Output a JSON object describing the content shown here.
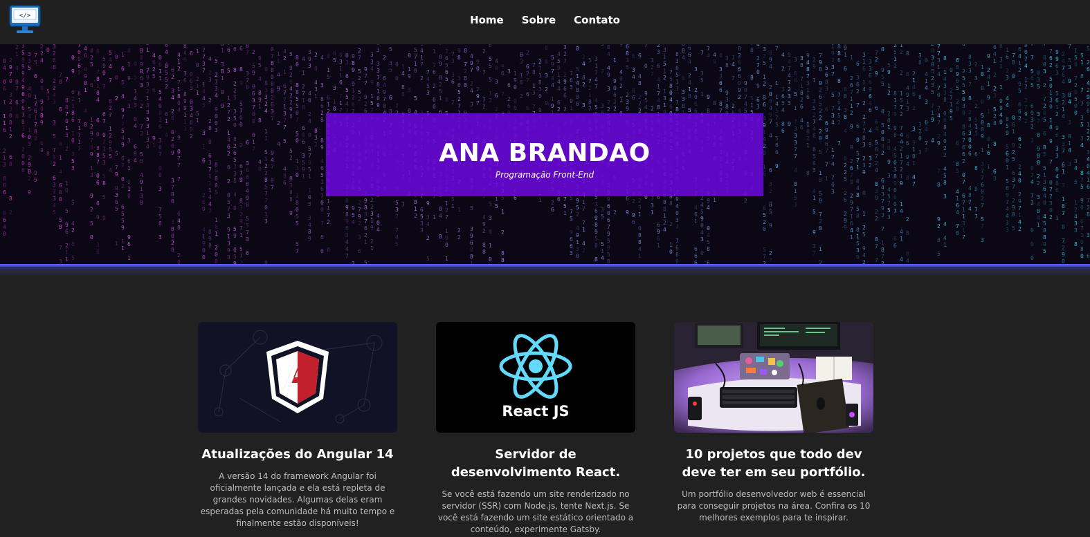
{
  "nav": {
    "logo_icon": "computer-code-icon",
    "links": [
      {
        "label": "Home"
      },
      {
        "label": "Sobre"
      },
      {
        "label": "Contato"
      }
    ]
  },
  "hero": {
    "title": "ANA BRANDAO",
    "subtitle": "Programação Front-End",
    "background": "matrix-code-rain",
    "accent_color": "#6e08e1"
  },
  "cards": [
    {
      "image": "angular-logo",
      "title": "Atualizações do Angular 14",
      "text": "A versão 14 do framework Angular foi oficialmente lançada e ela está repleta de grandes novidades. Algumas delas eram esperadas pela comunidade há muito tempo e finalmente estão disponíveis!"
    },
    {
      "image": "react-logo",
      "image_label": "React JS",
      "title": "Servidor de desenvolvimento React.",
      "text": "Se você está fazendo um site renderizado no servidor (SSR) com Node.js, tente Next.js. Se você está fazendo um site estático orientado a conteúdo, experimente Gatsby."
    },
    {
      "image": "developer-desk-photo",
      "title": "10 projetos que todo dev deve ter em seu portfólio.",
      "text": "Um portfólio desenvolvedor web é essencial para conseguir projetos na área. Confira os 10 melhores exemplos para te inspirar."
    }
  ]
}
